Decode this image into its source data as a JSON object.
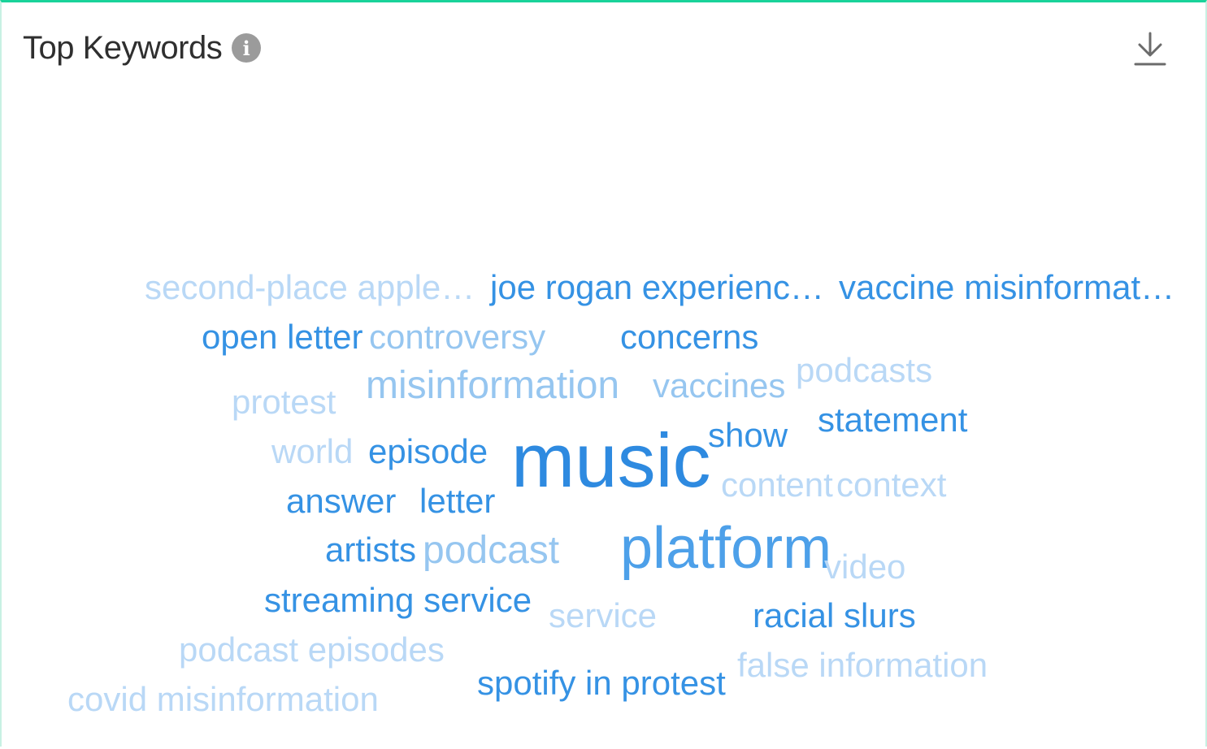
{
  "header": {
    "title": "Top Keywords",
    "info_icon": "info-icon",
    "info_glyph": "i",
    "download_icon": "download-icon"
  },
  "colors": {
    "accent_border": "#19d39a",
    "word_dark": "#2e8ae0",
    "word_light": "#b9d8f6"
  },
  "keywords": [
    {
      "text": "second-place apple…"
    },
    {
      "text": "joe rogan experienc…"
    },
    {
      "text": "vaccine misinformat…"
    },
    {
      "text": "open letter"
    },
    {
      "text": "controversy"
    },
    {
      "text": "concerns"
    },
    {
      "text": "podcasts"
    },
    {
      "text": "protest"
    },
    {
      "text": "misinformation"
    },
    {
      "text": "vaccines"
    },
    {
      "text": "statement"
    },
    {
      "text": "show"
    },
    {
      "text": "world"
    },
    {
      "text": "episode"
    },
    {
      "text": "music"
    },
    {
      "text": "content"
    },
    {
      "text": "context"
    },
    {
      "text": "answer"
    },
    {
      "text": "letter"
    },
    {
      "text": "artists"
    },
    {
      "text": "podcast"
    },
    {
      "text": "platform"
    },
    {
      "text": "video"
    },
    {
      "text": "streaming service"
    },
    {
      "text": "service"
    },
    {
      "text": "racial slurs"
    },
    {
      "text": "podcast episodes"
    },
    {
      "text": "false information"
    },
    {
      "text": "spotify in protest"
    },
    {
      "text": "covid misinformation"
    }
  ]
}
